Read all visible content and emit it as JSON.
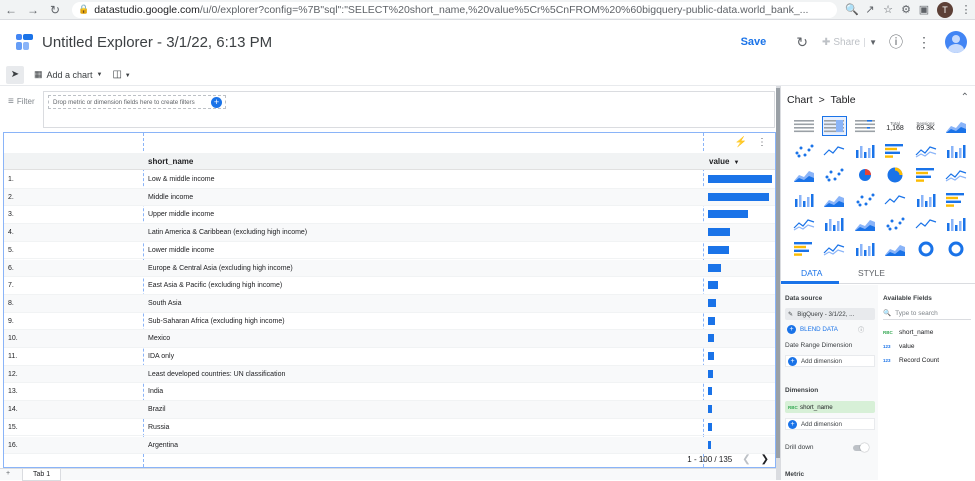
{
  "browser": {
    "url_domain": "datastudio.google.com",
    "url_rest": "/u/0/explorer?config=%7B\"sql\":\"SELECT%20short_name,%20value%5Cr%5CnFROM%20%60bigquery-public-data.world_bank_...",
    "avatar_letter": "T"
  },
  "header": {
    "title": "Untitled Explorer - 3/1/22, 6:13 PM",
    "save_label": "Save",
    "share_label": "Share"
  },
  "toolbar": {
    "add_chart_label": "Add a chart"
  },
  "filter": {
    "label": "Filter",
    "drop_hint": "Drop metric or dimension fields here to create filters"
  },
  "table": {
    "columns": [
      "short_name",
      "value"
    ],
    "rows": [
      {
        "idx": "1.",
        "name": "Low & middle income",
        "value": 1.0
      },
      {
        "idx": "2.",
        "name": "Middle income",
        "value": 0.96
      },
      {
        "idx": "3.",
        "name": "Upper middle income",
        "value": 0.62
      },
      {
        "idx": "4.",
        "name": "Latin America & Caribbean (excluding high income)",
        "value": 0.35
      },
      {
        "idx": "5.",
        "name": "Lower middle income",
        "value": 0.33
      },
      {
        "idx": "6.",
        "name": "Europe & Central Asia (excluding high income)",
        "value": 0.2
      },
      {
        "idx": "7.",
        "name": "East Asia & Pacific (excluding high income)",
        "value": 0.16
      },
      {
        "idx": "8.",
        "name": "South Asia",
        "value": 0.12
      },
      {
        "idx": "9.",
        "name": "Sub-Saharan Africa (excluding high income)",
        "value": 0.11
      },
      {
        "idx": "10.",
        "name": "Mexico",
        "value": 0.1
      },
      {
        "idx": "11.",
        "name": "IDA only",
        "value": 0.09
      },
      {
        "idx": "12.",
        "name": "Least developed countries: UN classification",
        "value": 0.08
      },
      {
        "idx": "13.",
        "name": "India",
        "value": 0.07
      },
      {
        "idx": "14.",
        "name": "Brazil",
        "value": 0.06
      },
      {
        "idx": "15.",
        "name": "Russia",
        "value": 0.06
      },
      {
        "idx": "16.",
        "name": "Argentina",
        "value": 0.05
      }
    ],
    "pagination": "1 - 100 / 135"
  },
  "tabs_bar": {
    "tab1": "Tab 1"
  },
  "panel": {
    "breadcrumb_chart": "Chart",
    "breadcrumb_sep": ">",
    "breadcrumb_type": "Table",
    "scorecard1_label": "Total",
    "scorecard1_value": "1,168",
    "scorecard2_label": "Sessions",
    "scorecard2_value": "69.3K",
    "tab_data": "DATA",
    "tab_style": "STYLE",
    "data_source_label": "Data source",
    "data_source_value": "BigQuery - 3/1/22, ...",
    "blend_label": "BLEND DATA",
    "date_range_label": "Date Range Dimension",
    "add_dimension": "Add dimension",
    "dimension_label": "Dimension",
    "dimension_value": "short_name",
    "dimension_type": "RBC",
    "drill_label": "Drill down",
    "metric_label": "Metric",
    "available_label": "Available Fields",
    "search_placeholder": "Type to search",
    "fields": [
      {
        "type": "RBC",
        "name": "short_name"
      },
      {
        "type": "123",
        "name": "value"
      },
      {
        "type": "123",
        "name": "Record Count"
      }
    ]
  },
  "colors": {
    "accent": "#1a73e8",
    "dimension_chip": "#d7f0d7"
  }
}
